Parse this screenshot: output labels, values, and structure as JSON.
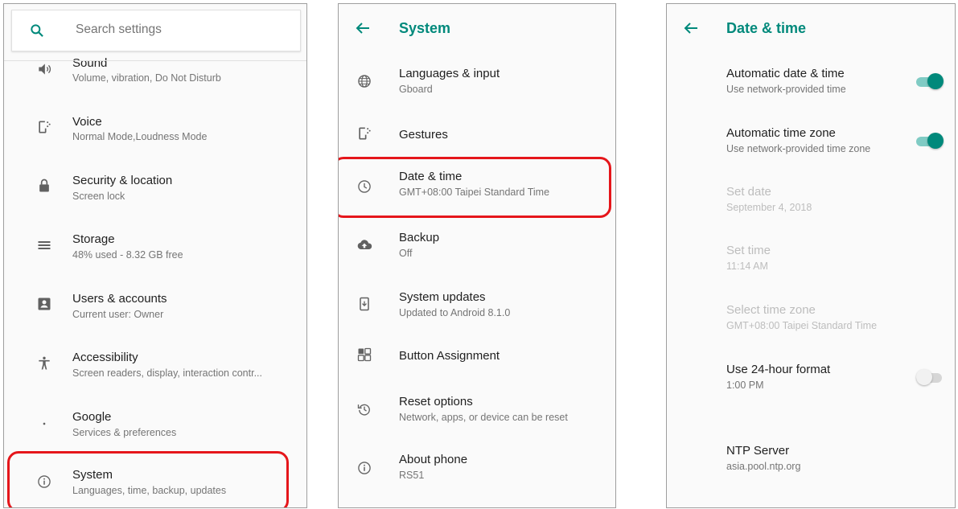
{
  "colors": {
    "accent": "#00897b",
    "highlight": "#e5161b",
    "secondary_text": "#757575",
    "disabled_text": "#bdbdbd"
  },
  "settings": {
    "search_placeholder": "Search settings",
    "items": [
      {
        "title": "Sound",
        "subtitle": "Volume, vibration, Do Not Disturb",
        "icon": "volume-icon"
      },
      {
        "title": "Voice",
        "subtitle": "Normal Mode,Loudness Mode",
        "icon": "voice-icon"
      },
      {
        "title": "Security & location",
        "subtitle": "Screen lock",
        "icon": "lock-icon"
      },
      {
        "title": "Storage",
        "subtitle": "48% used - 8.32 GB free",
        "icon": "storage-icon"
      },
      {
        "title": "Users & accounts",
        "subtitle": "Current user: Owner",
        "icon": "account-icon"
      },
      {
        "title": "Accessibility",
        "subtitle": "Screen readers, display, interaction contr...",
        "icon": "accessibility-icon"
      },
      {
        "title": "Google",
        "subtitle": "Services & preferences",
        "icon": "google-icon"
      },
      {
        "title": "System",
        "subtitle": "Languages, time, backup, updates",
        "icon": "info-icon"
      }
    ]
  },
  "system": {
    "title": "System",
    "items": [
      {
        "title": "Languages & input",
        "subtitle": "Gboard",
        "icon": "globe-icon"
      },
      {
        "title": "Gestures",
        "subtitle": "",
        "icon": "gestures-icon"
      },
      {
        "title": "Date & time",
        "subtitle": "GMT+08:00 Taipei Standard Time",
        "icon": "clock-icon"
      },
      {
        "title": "Backup",
        "subtitle": "Off",
        "icon": "cloud-upload-icon"
      },
      {
        "title": "System updates",
        "subtitle": "Updated to Android 8.1.0",
        "icon": "system-update-icon"
      },
      {
        "title": "Button Assignment",
        "subtitle": "",
        "icon": "button-assignment-icon"
      },
      {
        "title": "Reset options",
        "subtitle": "Network, apps, or device can be reset",
        "icon": "reset-icon"
      },
      {
        "title": "About phone",
        "subtitle": "RS51",
        "icon": "info-icon"
      }
    ]
  },
  "datetime": {
    "title": "Date & time",
    "items": [
      {
        "title": "Automatic date & time",
        "subtitle": "Use network-provided time",
        "toggle": true,
        "enabled": true
      },
      {
        "title": "Automatic time zone",
        "subtitle": "Use network-provided time zone",
        "toggle": true,
        "enabled": true
      },
      {
        "title": "Set date",
        "subtitle": "September 4, 2018",
        "enabled": false
      },
      {
        "title": "Set time",
        "subtitle": "11:14 AM",
        "enabled": false
      },
      {
        "title": "Select time zone",
        "subtitle": "GMT+08:00 Taipei Standard Time",
        "enabled": false
      },
      {
        "title": "Use 24-hour format",
        "subtitle": "1:00 PM",
        "toggle": false,
        "enabled": true
      },
      {
        "title": "NTP Server",
        "subtitle": "asia.pool.ntp.org",
        "enabled": true
      }
    ]
  }
}
